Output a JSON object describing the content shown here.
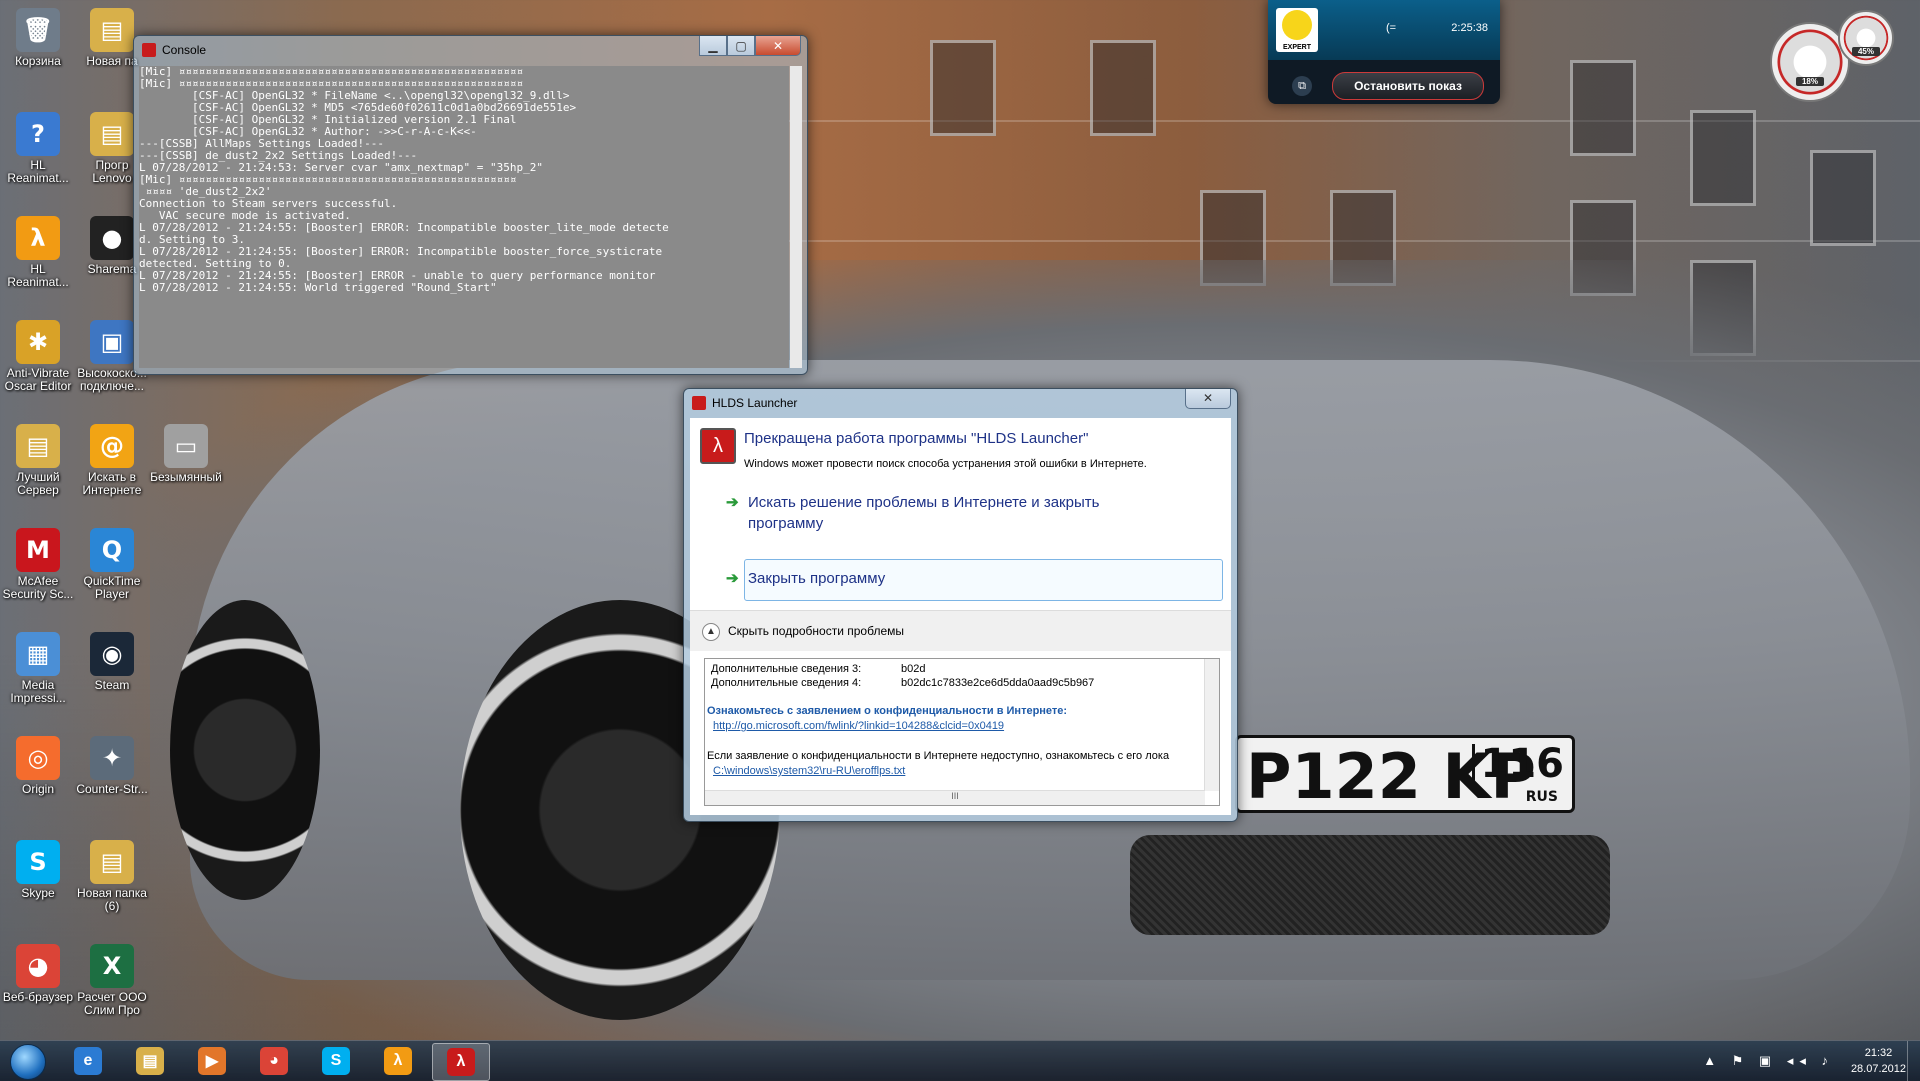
{
  "desktop": {
    "icons": [
      {
        "label": "Корзина",
        "glyph": "🗑",
        "color": "#6f7c8a"
      },
      {
        "label": "Новая па",
        "glyph": "▤",
        "color": "#d8b04a"
      },
      {
        "label": "HL Reanimat...",
        "glyph": "?",
        "color": "#3a7ad1"
      },
      {
        "label": "Прогр Lenovo",
        "glyph": "▤",
        "color": "#d8b04a"
      },
      {
        "label": "HL Reanimat...",
        "glyph": "λ",
        "color": "#f29b13"
      },
      {
        "label": "Sharema",
        "glyph": "●",
        "color": "#222222"
      },
      {
        "label": "Anti-Vibrate Oscar Editor",
        "glyph": "✱",
        "color": "#d9a227"
      },
      {
        "label": "Высокоско... подключе...",
        "glyph": "▣",
        "color": "#3e76c2"
      },
      {
        "label": "Лучший Сервер",
        "glyph": "▤",
        "color": "#d8b04a"
      },
      {
        "label": "Искать в Интернете",
        "glyph": "@",
        "color": "#f2a414"
      },
      {
        "label": "Безымянный",
        "glyph": "▭",
        "color": "#a0a0a0"
      },
      {
        "label": "McAfee Security Sc...",
        "glyph": "M",
        "color": "#c9161d"
      },
      {
        "label": "QuickTime Player",
        "glyph": "Q",
        "color": "#2a86d6"
      },
      {
        "label": "Media Impressi...",
        "glyph": "▦",
        "color": "#4b8fd6"
      },
      {
        "label": "Steam",
        "glyph": "◉",
        "color": "#1b2838"
      },
      {
        "label": "Origin",
        "glyph": "◎",
        "color": "#f56c2d"
      },
      {
        "label": "Counter-Str...",
        "glyph": "✦",
        "color": "#5c6b7a"
      },
      {
        "label": "Skype",
        "glyph": "S",
        "color": "#00aff0"
      },
      {
        "label": "Новая папка (6)",
        "glyph": "▤",
        "color": "#d8b04a"
      },
      {
        "label": "Веб-браузер",
        "glyph": "◕",
        "color": "#db4437"
      },
      {
        "label": "Расчет ООО Слим Про",
        "glyph": "X",
        "color": "#1d6f42"
      }
    ]
  },
  "console": {
    "title": "Console",
    "lines": [
      "[Mic] ¤¤¤¤¤¤¤¤¤¤¤¤¤¤¤¤¤¤¤¤¤¤¤¤¤¤¤¤¤¤¤¤¤¤¤¤¤¤¤¤¤¤¤¤¤¤¤¤¤¤¤¤",
      "[Mic] ¤¤¤¤¤¤¤¤¤¤¤¤¤¤¤¤¤¤¤¤¤¤¤¤¤¤¤¤¤¤¤¤¤¤¤¤¤¤¤¤¤¤¤¤¤¤¤¤¤¤¤¤",
      "",
      "        [CSF-AC] OpenGL32 * FileName <..\\opengl32\\opengl32_9.dll>",
      "",
      "        [CSF-AC] OpenGL32 * MD5 <765de60f02611c0d1a0bd26691de551e>",
      "",
      "        [CSF-AC] OpenGL32 * Initialized version 2.1 Final",
      "",
      "        [CSF-AC] OpenGL32 * Author: ->>C-r-A-c-K<<-",
      "",
      "---[CSSB] AllMaps Settings Loaded!---",
      "---[CSSB] de_dust2_2x2 Settings Loaded!---",
      "L 07/28/2012 - 21:24:53: Server cvar \"amx_nextmap\" = \"35hp_2\"",
      "[Mic] ¤¤¤¤¤¤¤¤¤¤¤¤¤¤¤¤¤¤¤¤¤¤¤¤¤¤¤¤¤¤¤¤¤¤¤¤¤¤¤¤¤¤¤¤¤¤¤¤¤¤¤",
      " ¤¤¤¤ 'de_dust2_2x2'",
      "Connection to Steam servers successful.",
      "   VAC secure mode is activated.",
      "L 07/28/2012 - 21:24:55: [Booster] ERROR: Incompatible booster_lite_mode detecte",
      "d. Setting to 3.",
      "L 07/28/2012 - 21:24:55: [Booster] ERROR: Incompatible booster_force_systicrate",
      "detected. Setting to 0.",
      "L 07/28/2012 - 21:24:55: [Booster] ERROR - unable to query performance monitor",
      "L 07/28/2012 - 21:24:55: World triggered \"Round_Start\""
    ]
  },
  "dialog": {
    "title": "HLDS Launcher",
    "heading": "Прекращена работа программы \"HLDS Launcher\"",
    "subtext": "Windows может провести поиск способа устранения этой ошибки в Интернете.",
    "option1": "Искать решение проблемы в Интернете и закрыть программу",
    "option2": "Закрыть программу",
    "details_toggle": "Скрыть подробности проблемы",
    "details": {
      "row1_key": "Дополнительные сведения 3:",
      "row1_val": "b02d",
      "row2_key": "Дополнительные сведения 4:",
      "row2_val": "b02dc1c7833e2ce6d5dda0aad9c5b967",
      "privacy_heading": "Ознакомьтесь с заявлением о конфиденциальности в Интернете:",
      "privacy_link": "http://go.microsoft.com/fwlink/?linkid=104288&clcid=0x0419",
      "offline_text": "Если заявление о конфиденциальности в Интернете недоступно, ознакомьтесь с его лока",
      "offline_link": "C:\\windows\\system32\\ru-RU\\erofflps.txt",
      "hscroll_grip": "III"
    }
  },
  "gadget": {
    "badge": "EXPERT",
    "status": "(=",
    "time": "2:25:38",
    "stop_label": "Остановить показ"
  },
  "meter": {
    "cpu": "18%",
    "ram": "45%"
  },
  "taskbar": {
    "apps": [
      {
        "name": "ie",
        "glyph": "e",
        "color": "#2b7bd3"
      },
      {
        "name": "explorer",
        "glyph": "▤",
        "color": "#d8b04a"
      },
      {
        "name": "media",
        "glyph": "▶",
        "color": "#e2762a"
      },
      {
        "name": "chrome",
        "glyph": "◕",
        "color": "#db4437"
      },
      {
        "name": "skype",
        "glyph": "S",
        "color": "#00aff0"
      },
      {
        "name": "halflife",
        "glyph": "λ",
        "color": "#f29b13"
      },
      {
        "name": "hlds",
        "glyph": "λ",
        "color": "#c81b1b"
      }
    ],
    "tray_icons": "▲ ⚑ ▣ ◂◂ ♪",
    "clock_time": "21:32",
    "clock_date": "28.07.2012"
  }
}
